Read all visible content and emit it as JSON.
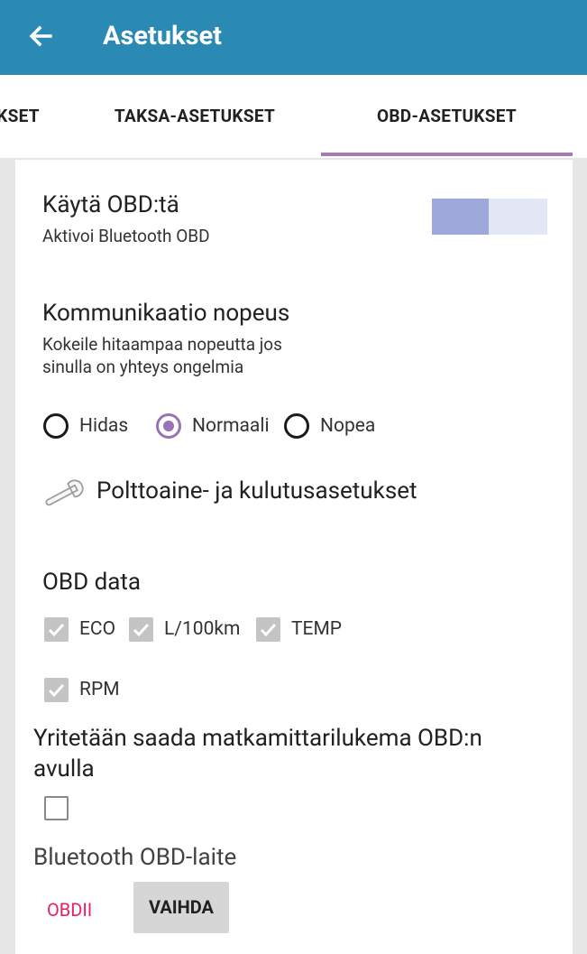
{
  "appbar": {
    "title": "Asetukset",
    "back_icon": "arrow-left-icon",
    "color": "#2a8ab4"
  },
  "tabs": [
    {
      "label": "KSET"
    },
    {
      "label": "TAKSA-ASETUKSET"
    },
    {
      "label": "OBD-ASETUKSET",
      "selected": true
    }
  ],
  "obd_toggle": {
    "title": "Käytä OBD:tä",
    "subtitle": "Aktivoi Bluetooth OBD"
  },
  "speed": {
    "title": "Kommunikaatio nopeus",
    "subtitle_line1": "Kokeile hitaampaa nopeutta jos",
    "subtitle_line2": "sinulla on yhteys ongelmia",
    "options": [
      {
        "label": "Hidas",
        "selected": false
      },
      {
        "label": "Normaali",
        "selected": true
      },
      {
        "label": "Nopea",
        "selected": false
      }
    ]
  },
  "fuel": {
    "label": "Polttoaine- ja kulutusasetukset",
    "icon": "wrench-icon"
  },
  "obd_data": {
    "title": "OBD data",
    "items": [
      {
        "label": "ECO",
        "checked": true
      },
      {
        "label": "L/100km",
        "checked": true
      },
      {
        "label": "TEMP",
        "checked": true
      },
      {
        "label": "RPM",
        "checked": true
      }
    ]
  },
  "odometer": {
    "line1": "Yritetään saada matkamittarilukema OBD:n",
    "line2": "avulla",
    "checked": false
  },
  "bt_device": {
    "title": "Bluetooth OBD-laite",
    "device": "OBDII",
    "change_label": "VAIHDA"
  },
  "colors": {
    "accent": "#9a73b4",
    "pink": "#e91e63"
  }
}
